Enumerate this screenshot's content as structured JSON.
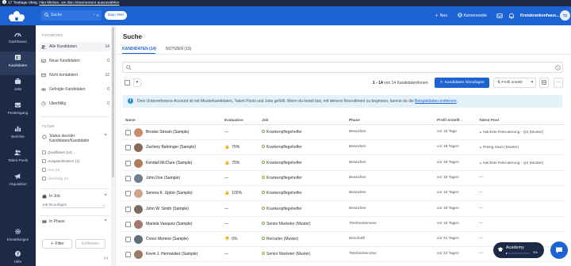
{
  "banner": {
    "text_start": "17 Testtage übrig. ",
    "link": "Hier klicken, um den Abonnement auszuwählen"
  },
  "topbar": {
    "search_placeholder": "Suche",
    "search_shortcut": "⌃ K",
    "test_label": "Dein Test",
    "new_label": "Neu",
    "career_label": "Karriereseite",
    "user_label": "Kreiskrankenhaus...",
    "avatar_initials": "TZ"
  },
  "nav": {
    "dashboard": "Dashboard",
    "candidates": "Kandidaten",
    "jobs": "Jobs",
    "inbox": "Posteingang",
    "reports": "Berichte",
    "talent_pools": "Talent Pools",
    "acquisition": "Akquisition",
    "settings": "Einstellungen",
    "help": "Hilfe"
  },
  "filters": {
    "favorites_heading": "FAVORITEN",
    "favorites": [
      {
        "label": "Alle Kandidaten",
        "count": "14"
      },
      {
        "label": "Neue Kandidaten",
        "count": "0"
      },
      {
        "label": "Nicht kontaktiert",
        "count": "12"
      },
      {
        "label": "Gefolgte Kandidaten",
        "count": "0"
      },
      {
        "label": "Überfällig",
        "count": "0"
      }
    ],
    "filter_heading": "FILTER",
    "status_title": "Status des/der Kandidaten/Kandidatin",
    "status_options": [
      "Qualifiziert (14)",
      "Ausgeschlossen (1)",
      "Neu (0)",
      "Überfällig (0)"
    ],
    "in_job_title": "In Job",
    "job_input_placeholder": "Job hinzufügen",
    "in_phase_title": "In Phase",
    "filter_button": "Filter",
    "remove_button": "Entfernen"
  },
  "main": {
    "title": "Suche",
    "tabs": [
      "KANDIDATEN (14)",
      "NOTIZEN (13)"
    ],
    "range_prefix": "1 - 14",
    "range_suffix": " von 14 Kandidaten/innen",
    "add_button": "Kandidaten hinzufügen",
    "sort_label": "Profil erstellt",
    "info_text": "Dein Unternehmens-Account ist mit Musterkandidaten, Talent Pools und Jobs gefüllt. Wenn du bereit bist, mit deinem Recruitment zu beginnen, kannst du die ",
    "info_link": "Beispieldaten entfernen",
    "info_end": "."
  },
  "table": {
    "headers": [
      "Name",
      "Evaluation",
      "Job",
      "Phase",
      "Profil erstellt",
      "Talent Pool"
    ],
    "rows": [
      {
        "name": "Brooke Strosin (Sample)",
        "eval": "—",
        "job": "Krankenpflegehelfer",
        "phase": "Beworben",
        "profil": "vor 15 Tage",
        "pool": "Nächste Rekrutierung - Q3 (Muster)"
      },
      {
        "name": "Zachery Bahringer (Sample)",
        "eval": "75%",
        "job": "Krankenpflegehelfer",
        "phase": "Beworben",
        "profil": "vor 18 Tagen",
        "pool": "Rising Stars (Muster)"
      },
      {
        "name": "Kendall McClure (Sample)",
        "eval": "75%",
        "job": "Krankenpflegehelfer",
        "phase": "Beworben",
        "profil": "vor 18 Tagen",
        "pool": "Nächste Rekrutierung - Q3 (Muster)"
      },
      {
        "name": "John Doe (Sample)",
        "eval": "—",
        "job": "Krankenpflegehelfer",
        "phase": "Beworben",
        "profil": "vor 15 Tagen",
        "pool": "—"
      },
      {
        "name": "Serena K. Upton (Sample)",
        "eval": "100%",
        "job": "Krankenpflegehelfer",
        "phase": "Beworben",
        "profil": "vor 15 Tagen",
        "pool": "—"
      },
      {
        "name": "John W. Smith (Sample)",
        "eval": "—",
        "job": "Krankenpflegehelfer",
        "phase": "Beworben",
        "profil": "vor 19 Tagen",
        "pool": "—"
      },
      {
        "name": "Mariela Vasquez (Sample)",
        "eval": "—",
        "job": "Senior Marketer (Muster)",
        "phase": "Telefoninterview",
        "profil": "vor 19 Tagen",
        "pool": "—"
      },
      {
        "name": "Conor Moreno (Sample)",
        "eval": "0%",
        "job": "Recruiter (Muster)",
        "phase": "Beschafft",
        "profil": "vor 21 Tagen",
        "pool": "—"
      },
      {
        "name": "Kevin J. Hernandez (Sample)",
        "eval": "—",
        "job": "Senior Marketer (Muster)",
        "phase": "Telefoninterview",
        "profil": "vor 22 Tagen",
        "pool": "—"
      }
    ]
  },
  "academy": {
    "label": "Academy",
    "progress_pct": 4,
    "progress_label": "4%"
  },
  "colors": {
    "brand": "#1d63d3",
    "nav_bg": "#1c2a48",
    "positive": "#43a047",
    "negative": "#333333"
  }
}
